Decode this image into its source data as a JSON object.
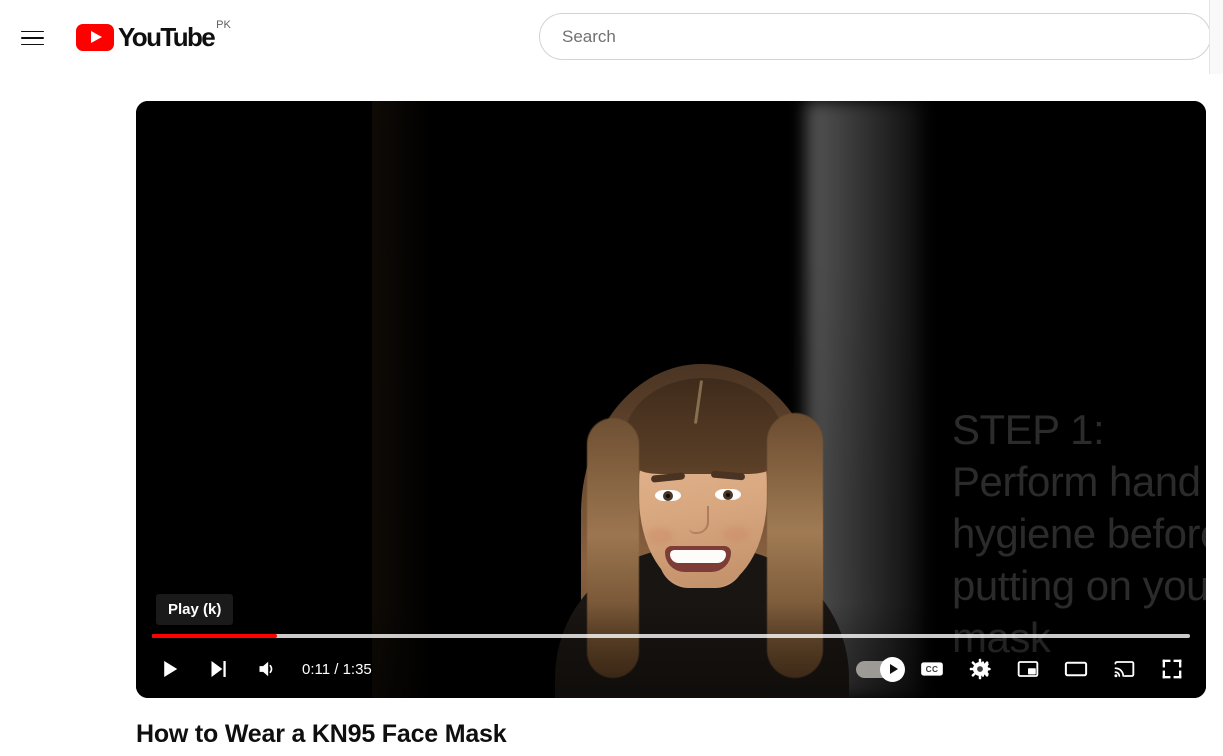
{
  "header": {
    "guide_label": "Guide menu",
    "logo_text": "YouTube",
    "logo_country": "PK",
    "search": {
      "placeholder": "Search",
      "value": ""
    }
  },
  "player": {
    "tooltip": "Play (k)",
    "time_current": "0:11",
    "time_total": "1:35",
    "time_display": "0:11 / 1:35",
    "progress_percent": 12,
    "loaded_percent": 100,
    "accent_color": "#ff0000",
    "autoplay_on": true,
    "overlay_text": {
      "line1": "STEP 1:",
      "line2": "Perform hand",
      "line3": "hygiene before",
      "line4": "putting on your",
      "line5": "mask"
    },
    "controls": {
      "play": "Play",
      "next": "Next",
      "volume": "Mute",
      "autoplay": "Autoplay",
      "subtitles": "Subtitles/closed captions",
      "settings": "Settings",
      "miniplayer": "Miniplayer",
      "theater": "Theater mode",
      "cast": "Play on TV",
      "fullscreen": "Full screen"
    }
  },
  "video": {
    "title": "How to Wear a KN95 Face Mask"
  }
}
